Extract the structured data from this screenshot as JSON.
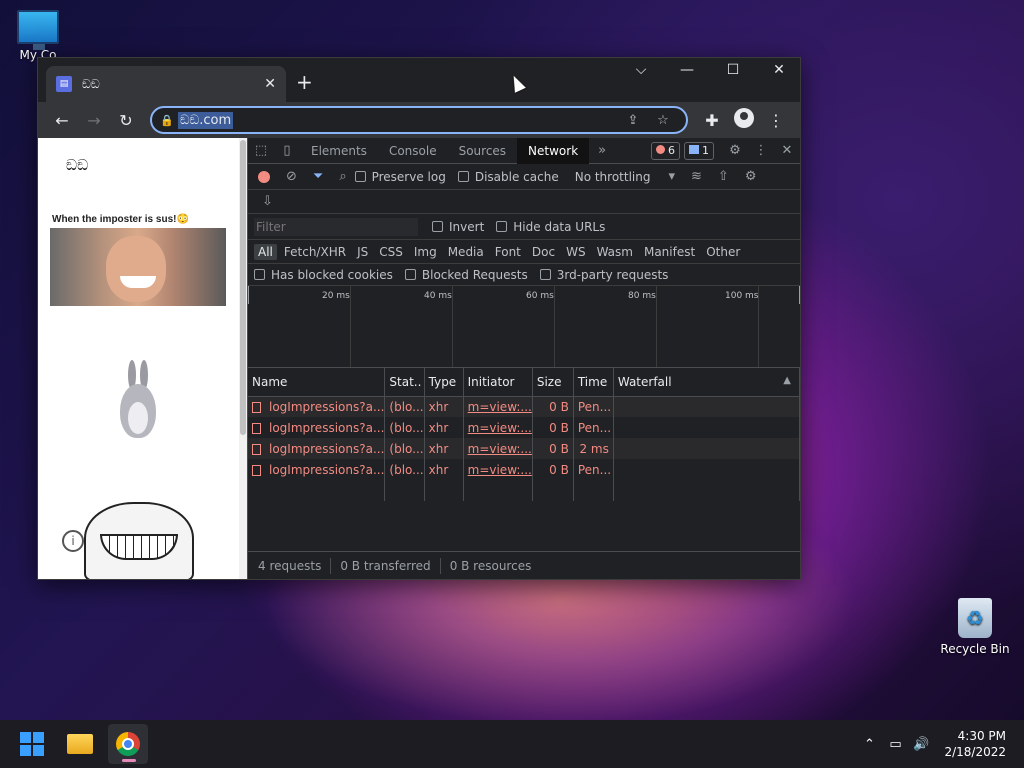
{
  "desktop": {
    "icons": [
      {
        "label": "My Co"
      },
      {
        "label": "Recycle Bin"
      }
    ]
  },
  "browser": {
    "tab": {
      "title": "ඞඞ",
      "favicon": "page-icon"
    },
    "new_tab": "+",
    "controls": {
      "dropdown": "⌵",
      "minimize": "—",
      "maximize": "☐",
      "close": "✕"
    },
    "omnibox": {
      "url": "ඞඞ.com"
    }
  },
  "page": {
    "heading": "ඞඞ",
    "caption": "When the imposter is sus!😳",
    "info_icon": "i"
  },
  "devtools": {
    "tabs": [
      "Elements",
      "Console",
      "Sources",
      "Network"
    ],
    "active_tab": "Network",
    "errors_count": "6",
    "messages_count": "1",
    "toolbar": {
      "preserve_log": "Preserve log",
      "disable_cache": "Disable cache",
      "throttling": "No throttling"
    },
    "filter": {
      "placeholder": "Filter",
      "invert": "Invert",
      "hide_data_urls": "Hide data URLs"
    },
    "type_filters": [
      "All",
      "Fetch/XHR",
      "JS",
      "CSS",
      "Img",
      "Media",
      "Font",
      "Doc",
      "WS",
      "Wasm",
      "Manifest",
      "Other"
    ],
    "blocked": {
      "has_blocked_cookies": "Has blocked cookies",
      "blocked_requests": "Blocked Requests",
      "third_party": "3rd-party requests"
    },
    "overview_ticks": [
      "20 ms",
      "40 ms",
      "60 ms",
      "80 ms",
      "100 ms"
    ],
    "columns": [
      "Name",
      "Stat..",
      "Type",
      "Initiator",
      "Size",
      "Time",
      "Waterfall"
    ],
    "rows": [
      {
        "name": "logImpressions?a...",
        "status": "(blo...",
        "type": "xhr",
        "initiator": "m=view:...",
        "size": "0 B",
        "time": "Pen..."
      },
      {
        "name": "logImpressions?a...",
        "status": "(blo...",
        "type": "xhr",
        "initiator": "m=view:...",
        "size": "0 B",
        "time": "Pen..."
      },
      {
        "name": "logImpressions?a...",
        "status": "(blo...",
        "type": "xhr",
        "initiator": "m=view:...",
        "size": "0 B",
        "time": "2 ms"
      },
      {
        "name": "logImpressions?a...",
        "status": "(blo...",
        "type": "xhr",
        "initiator": "m=view:...",
        "size": "0 B",
        "time": "Pen..."
      }
    ],
    "status": {
      "requests": "4 requests",
      "transferred": "0 B transferred",
      "resources": "0 B resources"
    }
  },
  "taskbar": {
    "clock_time": "4:30 PM",
    "clock_date": "2/18/2022"
  },
  "colors": {
    "accent": "#8ab4f8",
    "error": "#f28b82",
    "devtools_bg": "#202124"
  }
}
